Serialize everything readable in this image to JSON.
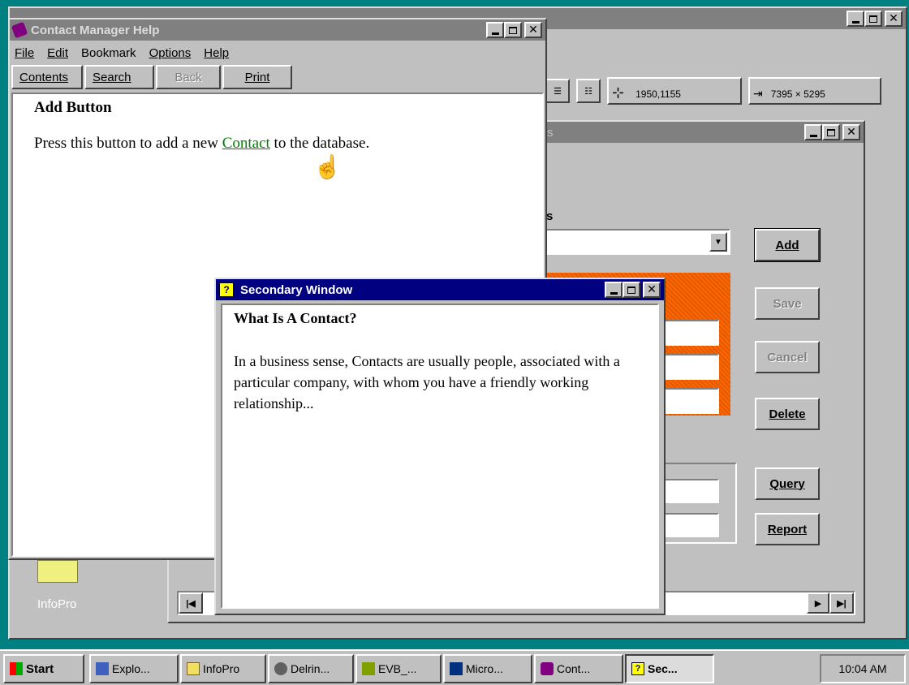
{
  "desktop": {
    "background": "#008080",
    "icon_label": "InfoPro"
  },
  "main_window": {
    "toolbar_coords": "1950,1155",
    "toolbar_size": "7395 × 5295"
  },
  "contacts_window": {
    "title_fragment": "s",
    "section_label_fragment": "ts",
    "buttons": {
      "add": "Add",
      "save": "Save",
      "cancel": "Cancel",
      "delete": "Delete",
      "query": "Query",
      "report": "Report"
    },
    "highlight_color": "#ff6600"
  },
  "help_window": {
    "title": "Contact Manager Help",
    "menu": [
      "File",
      "Edit",
      "Bookmark",
      "Options",
      "Help"
    ],
    "buttons": [
      "Contents",
      "Search",
      "Back",
      "Print"
    ],
    "heading": "Add Button",
    "body_before": "Press this button to add a new ",
    "link": "Contact",
    "body_after": " to the database.",
    "link_color": "#008000"
  },
  "secondary_window": {
    "title": "Secondary Window",
    "heading": "What Is A Contact?",
    "body": "In a business sense, Contacts are usually people, associated with a particular company, with whom you have a friendly working relationship..."
  },
  "taskbar": {
    "start": "Start",
    "items": [
      "Explo...",
      "InfoPro",
      "Delrin...",
      "EVB_...",
      "Micro...",
      "Cont...",
      "Sec..."
    ],
    "clock": "10:04 AM"
  }
}
